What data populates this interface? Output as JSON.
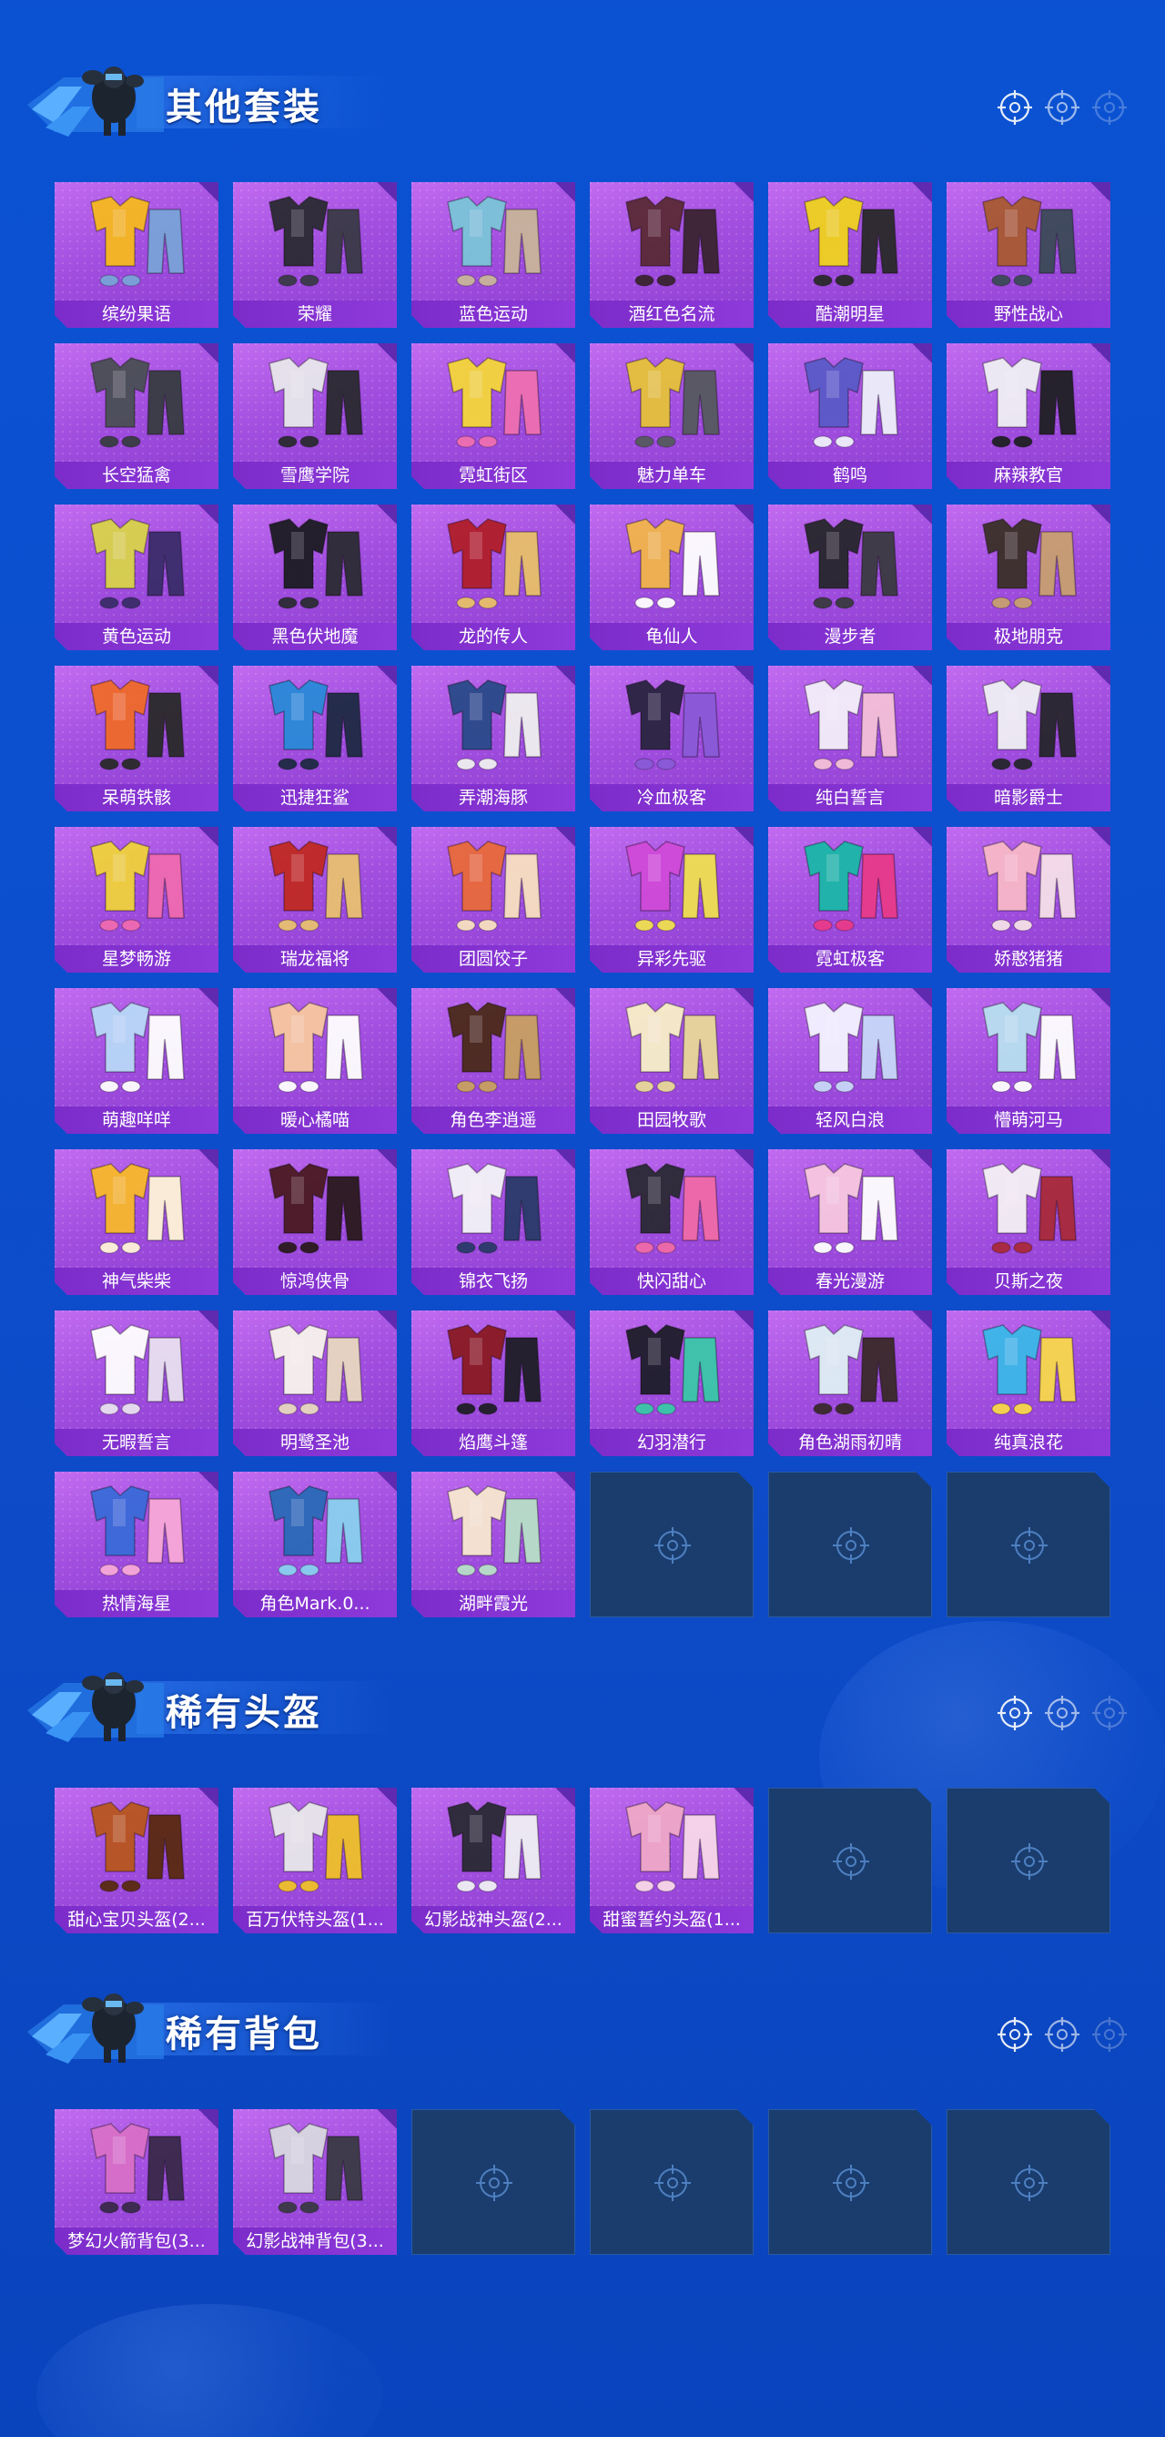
{
  "colors": {
    "background": "#0a52d2",
    "card_purple": "#a24fe0",
    "label_purple": "#7b2cc9",
    "empty_slot": "#1a3d6e"
  },
  "sections": [
    {
      "title": "其他套装",
      "items": [
        {
          "label": "缤纷果语",
          "art": [
            "#f7b91f",
            "#7aa3d8"
          ]
        },
        {
          "label": "荣耀",
          "art": [
            "#2b2b33",
            "#3a3a46"
          ]
        },
        {
          "label": "蓝色运动",
          "art": [
            "#7bc4d8",
            "#c9b59a"
          ]
        },
        {
          "label": "酒红色名流",
          "art": [
            "#5a2a36",
            "#3a2430"
          ]
        },
        {
          "label": "酷潮明星",
          "art": [
            "#f0d21e",
            "#2a2a2a"
          ]
        },
        {
          "label": "野性战心",
          "art": [
            "#a85a32",
            "#3c4a58"
          ]
        },
        {
          "label": "长空猛禽",
          "art": [
            "#4a4f55",
            "#383c42"
          ]
        },
        {
          "label": "雪鹰学院",
          "art": [
            "#e8e8ec",
            "#2a2a30"
          ]
        },
        {
          "label": "霓虹街区",
          "art": [
            "#f5d63a",
            "#ef6fb2"
          ]
        },
        {
          "label": "魅力单车",
          "art": [
            "#e6c23a",
            "#56595f"
          ]
        },
        {
          "label": "鹤鸣",
          "art": [
            "#5a5ac8",
            "#eef0fa"
          ]
        },
        {
          "label": "麻辣教官",
          "art": [
            "#f0f0f4",
            "#1f1f24"
          ]
        },
        {
          "label": "黄色运动",
          "art": [
            "#d9d34a",
            "#3a2d6a"
          ]
        },
        {
          "label": "黑色伏地魔",
          "art": [
            "#1c1c22",
            "#2c2c34"
          ]
        },
        {
          "label": "龙的传人",
          "art": [
            "#b01e2a",
            "#e8c06a"
          ]
        },
        {
          "label": "龟仙人",
          "art": [
            "#f2b54a",
            "#ffffff"
          ]
        },
        {
          "label": "漫步者",
          "art": [
            "#26262c",
            "#3a3a40"
          ]
        },
        {
          "label": "极地朋克",
          "art": [
            "#3a3028",
            "#c8a070"
          ]
        },
        {
          "label": "呆萌铁骸",
          "art": [
            "#f06a2a",
            "#2a2a2a"
          ]
        },
        {
          "label": "迅捷狂鲨",
          "art": [
            "#2a8ad8",
            "#1e2a44"
          ]
        },
        {
          "label": "弄潮海豚",
          "art": [
            "#2a4a8a",
            "#f0f0f0"
          ]
        },
        {
          "label": "冷血极客",
          "art": [
            "#2a2440",
            "#8a5ad8"
          ]
        },
        {
          "label": "纯白誓言",
          "art": [
            "#f4f0fa",
            "#f4c0d8"
          ]
        },
        {
          "label": "暗影爵士",
          "art": [
            "#f0f0f4",
            "#26262c"
          ]
        },
        {
          "label": "星梦畅游",
          "art": [
            "#f0d23a",
            "#f06ab0"
          ]
        },
        {
          "label": "瑞龙福将",
          "art": [
            "#c02a22",
            "#e8c070"
          ]
        },
        {
          "label": "团圆饺子",
          "art": [
            "#e86a3a",
            "#f8e0c0"
          ]
        },
        {
          "label": "异彩先驱",
          "art": [
            "#d04ad8",
            "#f0e050"
          ]
        },
        {
          "label": "霓虹极客",
          "art": [
            "#1ab8a8",
            "#e83a8a"
          ]
        },
        {
          "label": "娇憨猪猪",
          "art": [
            "#f8b8c8",
            "#f6e0e8"
          ]
        },
        {
          "label": "萌趣咩咩",
          "art": [
            "#b8d8f8",
            "#ffffff"
          ]
        },
        {
          "label": "暖心橘喵",
          "art": [
            "#f8c8a0",
            "#ffffff"
          ]
        },
        {
          "label": "角色李逍遥",
          "art": [
            "#4a2a1a",
            "#c8a060"
          ]
        },
        {
          "label": "田园牧歌",
          "art": [
            "#f8f0c8",
            "#e8d898"
          ]
        },
        {
          "label": "轻风白浪",
          "art": [
            "#f4f4ff",
            "#c8d8f8"
          ]
        },
        {
          "label": "懵萌河马",
          "art": [
            "#b8e0f0",
            "#ffffff"
          ]
        },
        {
          "label": "神气柴柴",
          "art": [
            "#f8b82a",
            "#fff4d8"
          ]
        },
        {
          "label": "惊鸿侠骨",
          "art": [
            "#4a1a22",
            "#2a1a1e"
          ]
        },
        {
          "label": "锦衣飞扬",
          "art": [
            "#f4f4f8",
            "#2a3a6a"
          ]
        },
        {
          "label": "快闪甜心",
          "art": [
            "#2a2a34",
            "#f06aa8"
          ]
        },
        {
          "label": "春光漫游",
          "art": [
            "#f8c8e0",
            "#ffffff"
          ]
        },
        {
          "label": "贝斯之夜",
          "art": [
            "#f4f0f4",
            "#a82a3a"
          ]
        },
        {
          "label": "无暇誓言",
          "art": [
            "#ffffff",
            "#e8e0f0"
          ]
        },
        {
          "label": "明鹭圣池",
          "art": [
            "#f8f4ec",
            "#e8d8c0"
          ]
        },
        {
          "label": "焰鹰斗篷",
          "art": [
            "#8a1a22",
            "#1e1e26"
          ]
        },
        {
          "label": "幻羽潜行",
          "art": [
            "#1e1e2a",
            "#3ac8a8"
          ]
        },
        {
          "label": "角色湖雨初晴",
          "art": [
            "#dff0f4",
            "#3a2a2a"
          ]
        },
        {
          "label": "纯真浪花",
          "art": [
            "#3ab8e8",
            "#f8d84a"
          ]
        },
        {
          "label": "热情海星",
          "art": [
            "#3a6ad8",
            "#f8a8d8"
          ]
        },
        {
          "label": "角色Mark.0...",
          "art": [
            "#2a6ab8",
            "#8ad0f0"
          ]
        },
        {
          "label": "湖畔霞光",
          "art": [
            "#f8e8d0",
            "#b8e0c8"
          ]
        }
      ],
      "empty_slots": 3
    },
    {
      "title": "稀有头盔",
      "items": [
        {
          "label": "甜心宝贝头盔(2...",
          "art": [
            "#b8561e",
            "#5a2a10"
          ]
        },
        {
          "label": "百万伏特头盔(1...",
          "art": [
            "#e8e8ea",
            "#f0c02a"
          ]
        },
        {
          "label": "幻影战神头盔(2...",
          "art": [
            "#2a2a34",
            "#f0f0f4"
          ]
        },
        {
          "label": "甜蜜誓约头盔(1...",
          "art": [
            "#f0a8c8",
            "#f8d8e8"
          ]
        }
      ],
      "empty_slots": 2
    },
    {
      "title": "稀有背包",
      "items": [
        {
          "label": "梦幻火箭背包(3...",
          "art": [
            "#d870c8",
            "#3a2a4a"
          ]
        },
        {
          "label": "幻影战神背包(3...",
          "art": [
            "#d8d8e0",
            "#3a3a44"
          ]
        }
      ],
      "empty_slots": 4
    }
  ]
}
